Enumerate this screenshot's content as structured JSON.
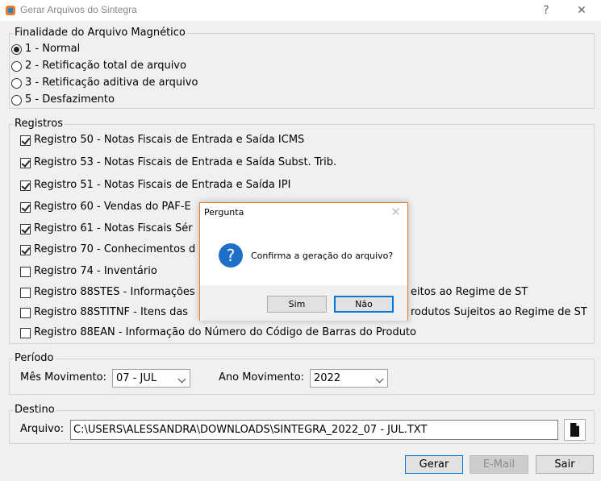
{
  "window": {
    "title": "Gerar Arquivos do Sintegra",
    "help": "?",
    "close": "✕"
  },
  "finalidade": {
    "title": "Finalidade do Arquivo Magnético",
    "options": [
      {
        "label": "1 - Normal",
        "selected": true
      },
      {
        "label": "2 - Retificação total de arquivo",
        "selected": false
      },
      {
        "label": "3 - Retificação aditiva de arquivo",
        "selected": false
      },
      {
        "label": "5 - Desfazimento",
        "selected": false
      }
    ]
  },
  "registros": {
    "title": "Registros",
    "items": [
      {
        "label": "Registro 50 - Notas Fiscais de Entrada e Saída ICMS",
        "checked": true
      },
      {
        "label": "Registro 53 - Notas Fiscais de Entrada e Saída Subst. Trib.",
        "checked": true
      },
      {
        "label": "Registro 51 - Notas Fiscais de Entrada e Saída IPI",
        "checked": true
      },
      {
        "label": "Registro 60 - Vendas do PAF-E",
        "checked": true
      },
      {
        "label": "Registro 61 - Notas Fiscais Sér",
        "checked": true
      },
      {
        "label": "Registro 70 - Conhecimentos d",
        "checked": true
      },
      {
        "label": "Registro 74 - Inventário",
        "checked": false
      },
      {
        "label": "Registro 88STES - Informações",
        "suffix": "eitos ao Regime de ST",
        "checked": false
      },
      {
        "label": "Registro 88STITNF - Itens das",
        "suffix": "rodutos Sujeitos ao Regime de ST",
        "checked": false
      },
      {
        "label": "Registro 88EAN - Informação do Número do Código de Barras do Produto",
        "checked": false
      }
    ]
  },
  "periodo": {
    "title": "Período",
    "mes_label": "Mês Movimento:",
    "mes_value": "07 - JUL",
    "ano_label": "Ano Movimento:",
    "ano_value": "2022"
  },
  "destino": {
    "title": "Destino",
    "arquivo_label": "Arquivo:",
    "arquivo_value": "C:\\USERS\\ALESSANDRA\\DOWNLOADS\\SINTEGRA_2022_07 - JUL.TXT"
  },
  "buttons": {
    "gerar": "Gerar",
    "email": "E-Mail",
    "sair": "Sair"
  },
  "dialog": {
    "title": "Pergunta",
    "close": "✕",
    "icon": "question-icon",
    "message": "Confirma a geração do arquivo?",
    "yes": "Sim",
    "no": "Não"
  },
  "colors": {
    "accent": "#0078d7",
    "dialog_border": "#e87c24",
    "question_icon": "#1d6fc7"
  }
}
